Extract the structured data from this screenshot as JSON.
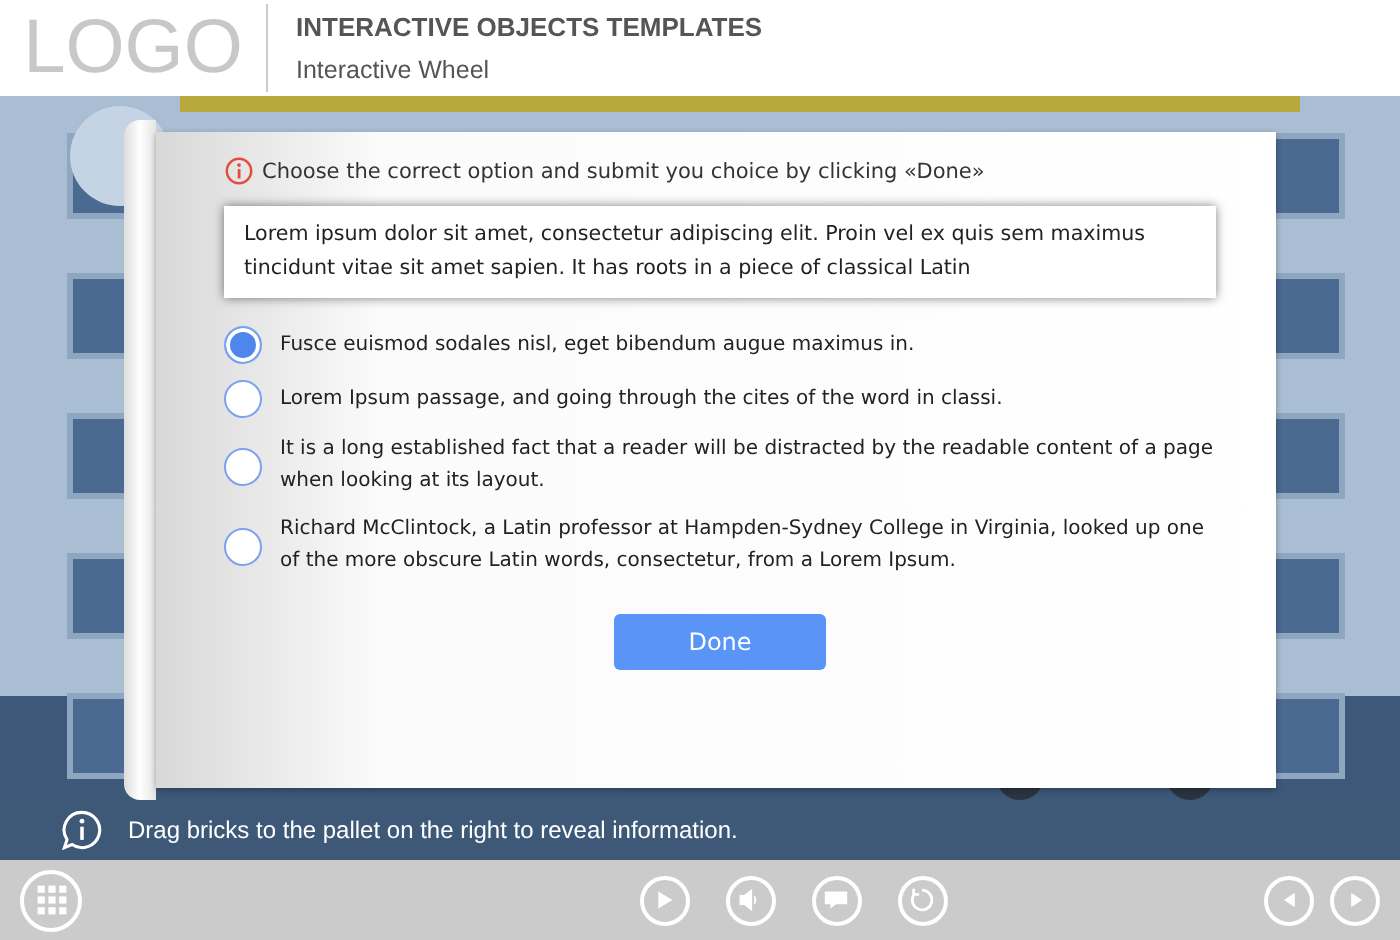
{
  "header": {
    "logo": "LOGO",
    "title": "INTERACTIVE OBJECTS TEMPLATES",
    "subtitle": "Interactive Wheel"
  },
  "question": {
    "instruction": "Choose the correct option and submit you choice by clicking «Done»",
    "prompt": "Lorem ipsum dolor sit amet, consectetur adipiscing elit. Proin vel ex quis sem maximus tincidunt vitae sit amet sapien. It has roots in a piece of classical Latin",
    "options": [
      {
        "label": "Fusce euismod sodales nisl, eget bibendum augue maximus in.",
        "selected": true
      },
      {
        "label": "Lorem Ipsum passage, and going through the cites of the word in classi.",
        "selected": false
      },
      {
        "label": "It is a long established fact that a reader will be distracted by the readable content of a page when looking at its layout.",
        "selected": false
      },
      {
        "label": "Richard McClintock, a Latin professor at Hampden-Sydney College in Virginia, looked up one of the more obscure Latin words, consectetur, from a Lorem Ipsum.",
        "selected": false
      }
    ],
    "button": "Done"
  },
  "hint": "Drag bricks to the pallet on the right to reveal information.",
  "toolbar": [
    {
      "kind": "menu"
    },
    {
      "kind": "play"
    },
    {
      "kind": "sound"
    },
    {
      "kind": "captions"
    },
    {
      "kind": "replay"
    },
    {
      "kind": "prev"
    },
    {
      "kind": "next"
    }
  ]
}
